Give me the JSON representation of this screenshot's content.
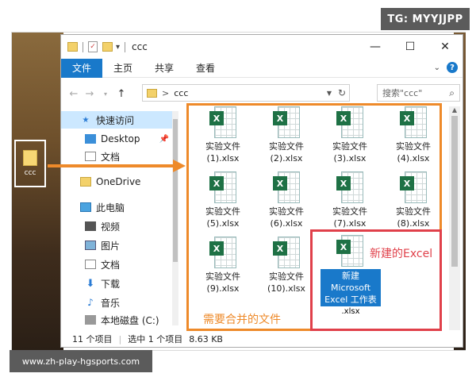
{
  "watermark": "TG: MYYJJPP",
  "footer_url": "www.zh-play-hgsports.com",
  "desktop_icon": {
    "label": "ccc"
  },
  "window": {
    "title": "ccc",
    "controls": {
      "minimize": "—",
      "maximize": "☐",
      "close": "✕"
    },
    "ribbon_tabs": [
      "文件",
      "主页",
      "共享",
      "查看"
    ],
    "help": "?",
    "address": {
      "path": "ccc",
      "separator": ">"
    },
    "search": {
      "placeholder": "搜索\"ccc\""
    }
  },
  "sidebar": {
    "items": [
      {
        "label": "快速访问",
        "icon": "star-icon"
      },
      {
        "label": "Desktop",
        "icon": "desktop-icon"
      },
      {
        "label": "文档",
        "icon": "documents-icon"
      },
      {
        "label": "OneDrive",
        "icon": "folder-icon"
      },
      {
        "label": "此电脑",
        "icon": "computer-icon"
      },
      {
        "label": "视频",
        "icon": "video-icon"
      },
      {
        "label": "图片",
        "icon": "pictures-icon"
      },
      {
        "label": "文档",
        "icon": "documents-icon"
      },
      {
        "label": "下载",
        "icon": "download-icon"
      },
      {
        "label": "音乐",
        "icon": "music-icon"
      },
      {
        "label": "本地磁盘 (C:)",
        "icon": "disk-icon"
      }
    ]
  },
  "files": [
    {
      "line1": "实验文件",
      "line2": "(1).xlsx"
    },
    {
      "line1": "实验文件",
      "line2": "(2).xlsx"
    },
    {
      "line1": "实验文件",
      "line2": "(3).xlsx"
    },
    {
      "line1": "实验文件",
      "line2": "(4).xlsx"
    },
    {
      "line1": "实验文件",
      "line2": "(5).xlsx"
    },
    {
      "line1": "实验文件",
      "line2": "(6).xlsx"
    },
    {
      "line1": "实验文件",
      "line2": "(7).xlsx"
    },
    {
      "line1": "实验文件",
      "line2": "(8).xlsx"
    },
    {
      "line1": "实验文件",
      "line2": "(9).xlsx"
    },
    {
      "line1": "实验文件",
      "line2": "(10).xlsx"
    }
  ],
  "new_file": {
    "line1": "新建",
    "line2": "Microsoft",
    "line3": "Excel 工作表",
    "line4": ".xlsx"
  },
  "status": {
    "count": "11 个项目",
    "selection": "选中 1 个项目",
    "size": "8.63 KB"
  },
  "annotations": {
    "merge_label": "需要合并的文件",
    "new_label": "新建的Excel"
  },
  "colors": {
    "accent": "#1979ca",
    "orange": "#ee8a2a",
    "red": "#e0404a",
    "excel": "#1e7145"
  }
}
